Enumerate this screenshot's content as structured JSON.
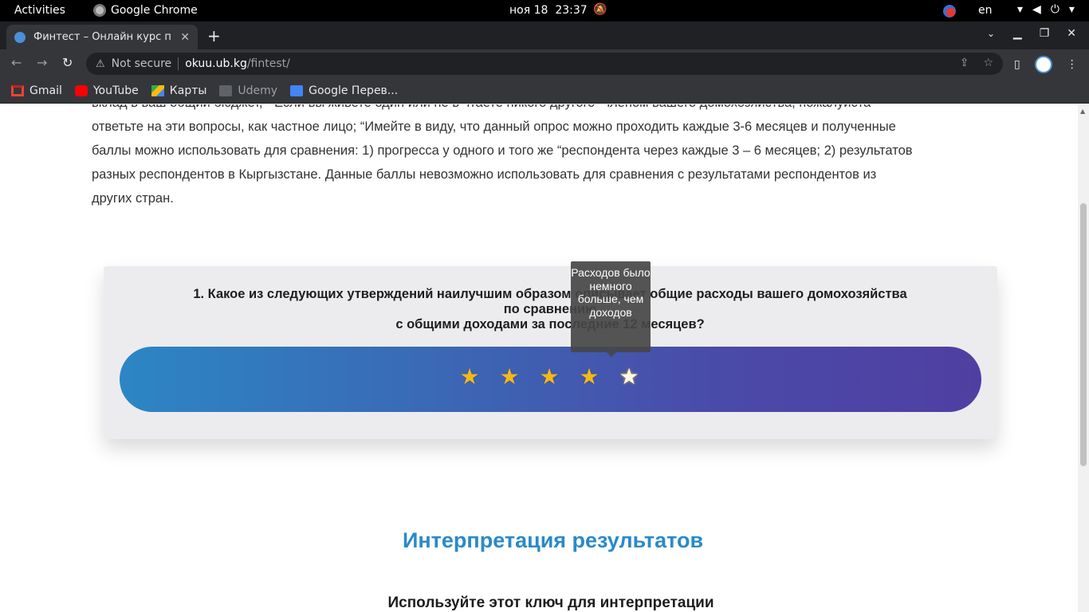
{
  "system_bar": {
    "activities": "Activities",
    "app_name": "Google Chrome",
    "date": "ноя 18",
    "time": "23:37",
    "language": "en"
  },
  "browser": {
    "tab_title": "Финтест – Онлайн курс п",
    "security_label": "Not secure",
    "url_host": "okuu.ub.kg",
    "url_path": "/fintest/",
    "bookmarks": [
      "Gmail",
      "YouTube",
      "Карты",
      "Udemy",
      "Google Перев..."
    ]
  },
  "page": {
    "intro_lines": [
      "вклад в ваш общий бюджет, “ Если вы живете один или не в чтаете никого другого “членом вашего домохозяйства, пожалуйста",
      "ответьте на эти вопросы, как частное лицо; “Имейте в виду, что данный опрос можно проходить каждые 3-6 месяцев и полученные",
      "баллы можно использовать для сравнения: 1) прогресса у одного и того же “респондента через каждые 3 – 6 месяцев; 2) результатов",
      "разных респондентов в Кыргызстане. Данные баллы невозможно использовать для сравнения с результатами респондентов из",
      "других стран."
    ],
    "question": {
      "line1": "1. Какое из следующих утверждений наилучшим образом описывает общие расходы вашего домохозяйства",
      "line2": "по сравнению",
      "line3": "с общими доходами за последние 12 месяцев?"
    },
    "rating": {
      "max": 5,
      "hovered": 4,
      "star_glyph": "★"
    },
    "tooltip": "Расходов было немного больше, чем доходов",
    "section_title": "Интерпретация результатов",
    "section_subtitle": "Используйте этот ключ для интерпретации"
  }
}
